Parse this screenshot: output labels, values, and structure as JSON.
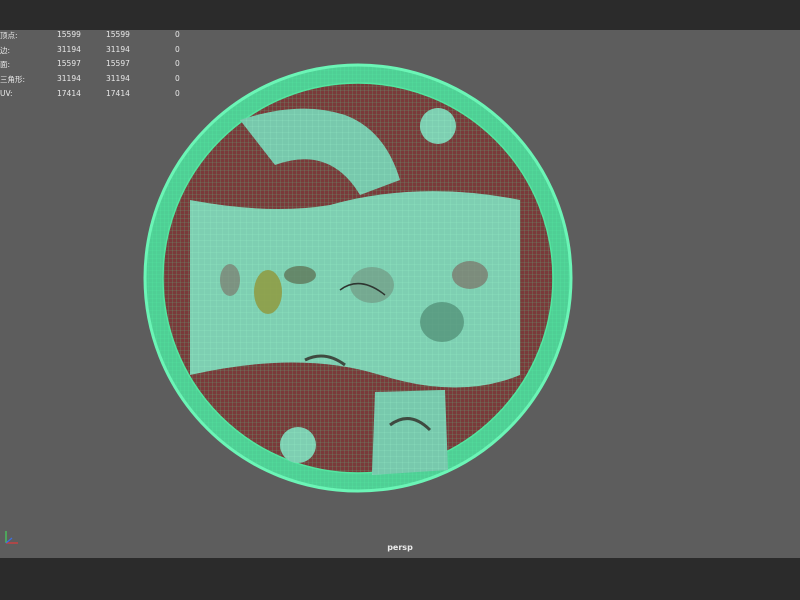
{
  "hud": {
    "rows": [
      {
        "label": "顶点:",
        "v1": "15599",
        "v2": "15599",
        "v3": "0"
      },
      {
        "label": "边:",
        "v1": "31194",
        "v2": "31194",
        "v3": "0"
      },
      {
        "label": "面:",
        "v1": "15597",
        "v2": "15597",
        "v3": "0"
      },
      {
        "label": "三角形:",
        "v1": "31194",
        "v2": "31194",
        "v3": "0"
      },
      {
        "label": "UV:",
        "v1": "17414",
        "v2": "17414",
        "v3": "0"
      }
    ]
  },
  "viewport": {
    "camera_label": "persp",
    "wire_color": "#53e6a0",
    "plate_color": "#7a3a3a",
    "panel_color": "#78c9ad"
  }
}
